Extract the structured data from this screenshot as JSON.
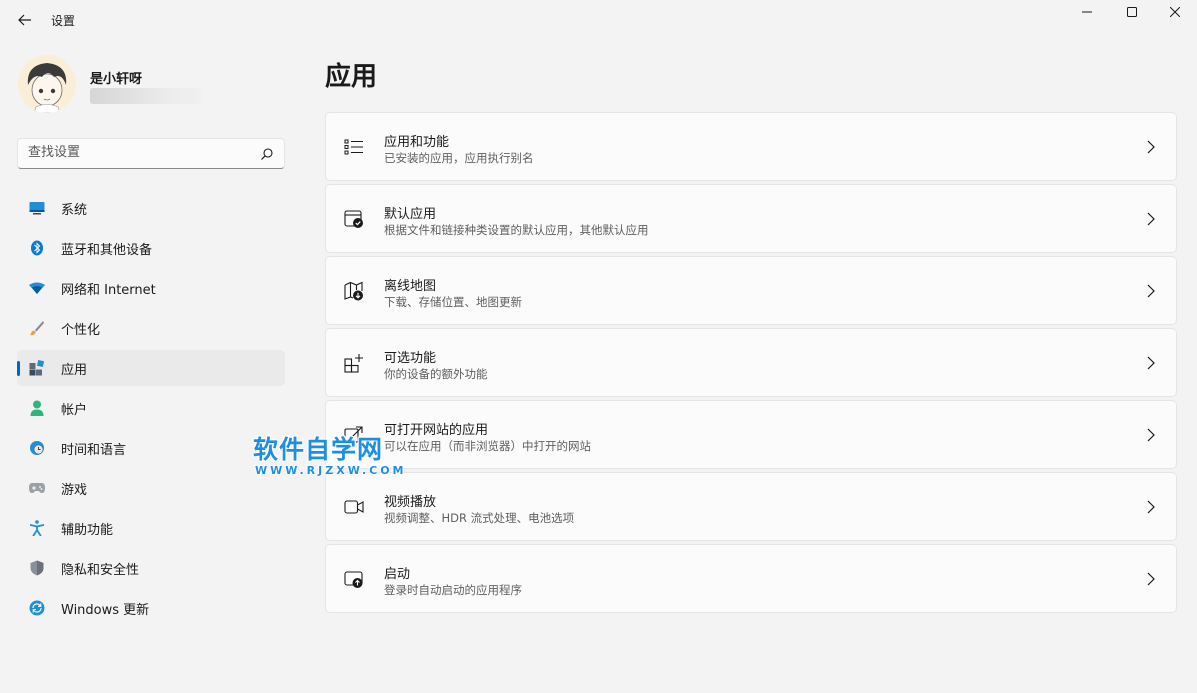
{
  "window": {
    "title": "设置",
    "controls": [
      "minimize",
      "maximize",
      "close"
    ]
  },
  "profile": {
    "name": "是小轩呀"
  },
  "search": {
    "placeholder": "查找设置"
  },
  "sidebar": {
    "items": [
      {
        "label": "系统",
        "icon": "system-display-icon",
        "active": false
      },
      {
        "label": "蓝牙和其他设备",
        "icon": "bluetooth-icon",
        "active": false
      },
      {
        "label": "网络和 Internet",
        "icon": "wifi-icon",
        "active": false
      },
      {
        "label": "个性化",
        "icon": "brush-icon",
        "active": false
      },
      {
        "label": "应用",
        "icon": "apps-icon",
        "active": true
      },
      {
        "label": "帐户",
        "icon": "account-icon",
        "active": false
      },
      {
        "label": "时间和语言",
        "icon": "globe-clock-icon",
        "active": false
      },
      {
        "label": "游戏",
        "icon": "gamepad-icon",
        "active": false
      },
      {
        "label": "辅助功能",
        "icon": "accessibility-icon",
        "active": false
      },
      {
        "label": "隐私和安全性",
        "icon": "shield-icon",
        "active": false
      },
      {
        "label": "Windows 更新",
        "icon": "update-icon",
        "active": false
      }
    ]
  },
  "main": {
    "title": "应用",
    "cards": [
      {
        "title": "应用和功能",
        "subtitle": "已安装的应用，应用执行别名",
        "icon": "list-icon"
      },
      {
        "title": "默认应用",
        "subtitle": "根据文件和链接种类设置的默认应用，其他默认应用",
        "icon": "default-app-icon"
      },
      {
        "title": "离线地图",
        "subtitle": "下载、存储位置、地图更新",
        "icon": "map-download-icon"
      },
      {
        "title": "可选功能",
        "subtitle": "你的设备的额外功能",
        "icon": "add-feature-icon"
      },
      {
        "title": "可打开网站的应用",
        "subtitle": "可以在应用（而非浏览器）中打开的网站",
        "icon": "open-link-icon"
      },
      {
        "title": "视频播放",
        "subtitle": "视频调整、HDR 流式处理、电池选项",
        "icon": "video-icon"
      },
      {
        "title": "启动",
        "subtitle": "登录时自动启动的应用程序",
        "icon": "startup-icon"
      }
    ]
  },
  "watermark": {
    "main": "软件自学网",
    "sub": "WWW.RJZXW.COM"
  },
  "colors": {
    "accent": "#0067c0",
    "background": "#f3f3f3",
    "card": "#fbfbfb",
    "watermark": "#1e8fe0"
  }
}
